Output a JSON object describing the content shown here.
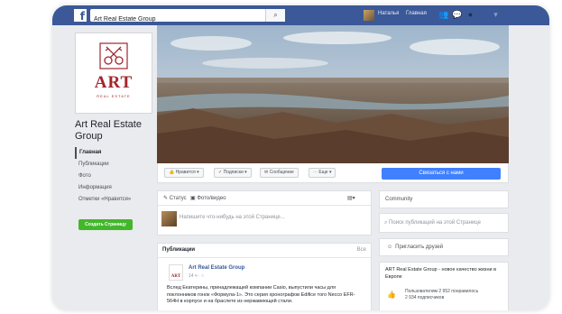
{
  "topbar": {
    "logo": "f",
    "search_value": "Art Real Estate Group",
    "search_icon": "search-icon",
    "user_name": "Наталья",
    "home_label": "Главная",
    "icons": [
      "friend-requests-icon",
      "messages-icon",
      "globe-icon",
      "help-icon"
    ]
  },
  "profile": {
    "logo_text": "ART",
    "logo_sub": "REAL ESTATE",
    "page_name": "Art Real Estate Group"
  },
  "nav": {
    "items": [
      "Главная",
      "Публикации",
      "Фото",
      "Информация",
      "Отметки «Нравится»"
    ],
    "create_page": "Создать Страницу"
  },
  "actions": {
    "like": "Нравится",
    "follow": "Подписки",
    "message": "Сообщение",
    "more": "Еще",
    "primary": "Связаться с нами"
  },
  "composer": {
    "tab_status": "Статус",
    "tab_photo": "Фото/видео",
    "placeholder": "Напишите что-нибудь на этой Странице..."
  },
  "publications": {
    "title": "Публикации",
    "see_all": "Все",
    "post": {
      "author": "Art Real Estate Group",
      "time": "14 ч · ",
      "logo": "ART",
      "text": "Вслед Екатерины, принадлежащей компании Casio, выпустили часы для поклонников гонок «Формула-1». Это серия хронографов Edifice того Necco EFR-564H в корпусе и на браслете из нержавеющей стали."
    }
  },
  "sidebar": {
    "community_title": "Community",
    "search_placeholder": "Поиск публикаций на этой Странице",
    "invite": "Пригласить друзей",
    "news_text": "ART Real Estate Group - новое качество жизни в Европе",
    "likes_text": "Пользователям 2 952 понравилось",
    "followers_text": "2 934 подписчиков"
  },
  "colors": {
    "facebook_blue": "#3b5998",
    "primary_button": "#4080ff",
    "create_button": "#42b72a",
    "brand_red": "#a1262c"
  }
}
